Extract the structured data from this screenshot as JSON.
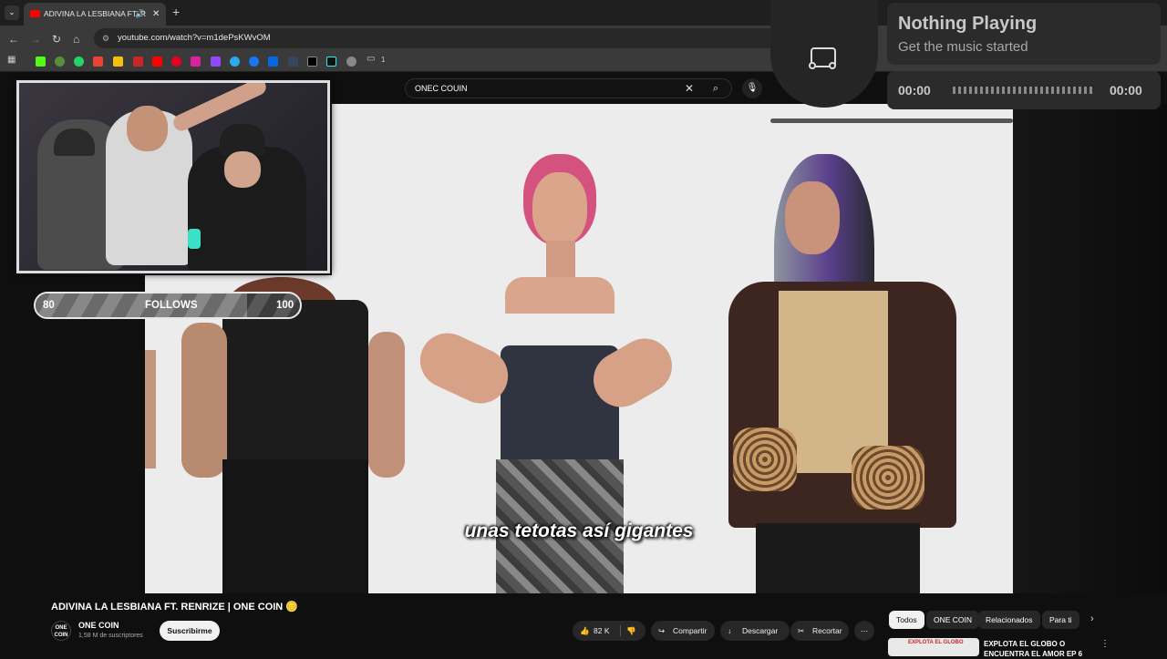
{
  "browser": {
    "tab_title": "ADIVINA LA LESBIANA FT. R",
    "url": "youtube.com/watch?v=m1dePsKWvOM",
    "bookmark_folder_count": "1"
  },
  "youtube": {
    "search_value": "ONEC COUIN",
    "video_title": "ADIVINA LA LESBIANA FT. RENRIZE | ONE COIN 🪙",
    "channel_name": "ONE COIN",
    "channel_avatar_text": "ONE COIN",
    "subscribers": "1,58 M de suscriptores",
    "subscribe_label": "Suscribirme",
    "like_count": "82 K",
    "share_label": "Compartir",
    "download_label": "Descargar",
    "clip_label": "Recortar",
    "chips": [
      "Todos",
      "ONE COIN",
      "Relacionados",
      "Para ti"
    ],
    "recommended_title": "EXPLOTA EL GLOBO O ENCUENTRA EL AMOR EP 6",
    "thumb_caption": "EXPLOTA EL GLOBO"
  },
  "video": {
    "subtitle": "unas tetotas así gigantes"
  },
  "overlay": {
    "follows_label": "FOLLOWS",
    "follows_current": "80",
    "follows_goal": "100",
    "follows_progress": 0.8
  },
  "now_playing": {
    "title": "Nothing Playing",
    "subtitle": "Get the music started",
    "time_start": "00:00",
    "time_end": "00:00"
  },
  "colors": {
    "youtube_red": "#ff0000",
    "page_bg": "#0f0f0f",
    "chip_active_bg": "#f1f1f1"
  }
}
